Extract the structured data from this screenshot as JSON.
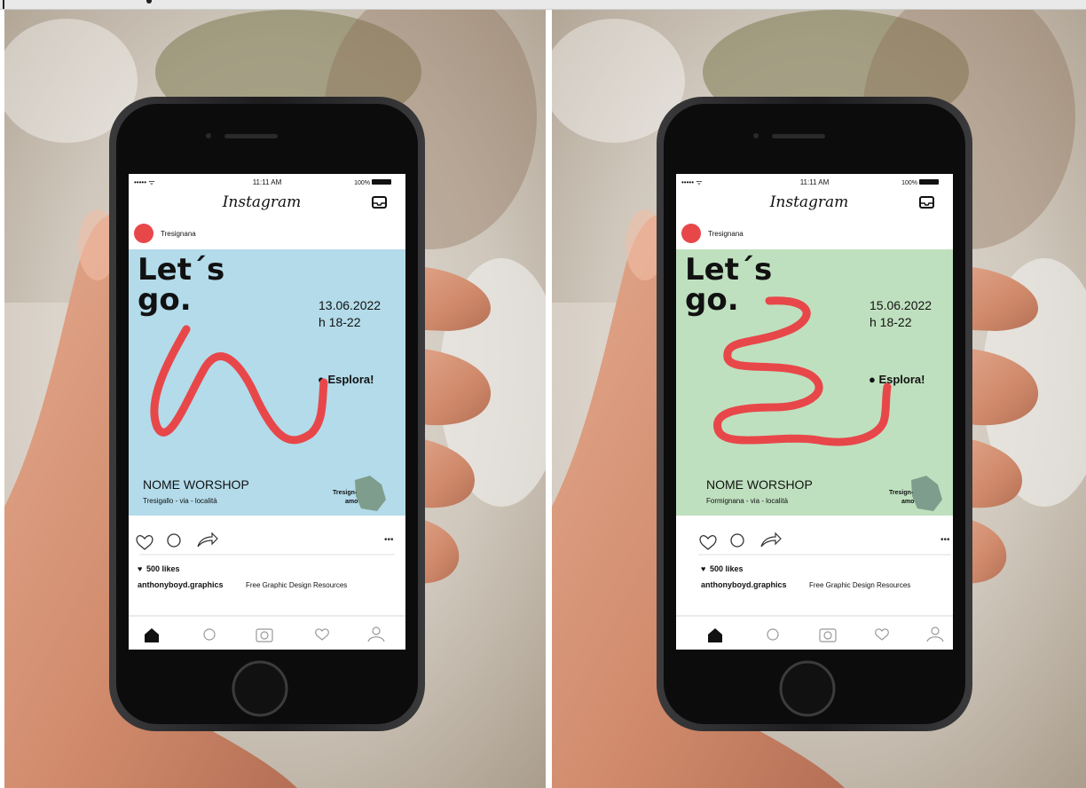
{
  "colors": {
    "post_left_bg": "#b3dbea",
    "post_right_bg": "#bfe0bf",
    "squiggle": "#e8474a",
    "text_dark": "#111111"
  },
  "panels": [
    {
      "status": {
        "time": "11:11 AM",
        "battery": "100%"
      },
      "app_title": "Instagram",
      "account": "Tresignana",
      "post": {
        "headline_line1": "Let´s",
        "headline_line2": "go.",
        "date": "13.06.2022",
        "hours": "h 18-22",
        "cta": "● Esplora!",
        "event_name": "NOME WORSHOP",
        "location": "Tresigallo - via - località",
        "logo_text_1": "Tresign-",
        "logo_text_2": "amo"
      },
      "likes": "500 likes",
      "caption_user": "anthonyboyd.graphics",
      "caption_text": "Free Graphic Design Resources"
    },
    {
      "status": {
        "time": "11:11 AM",
        "battery": "100%"
      },
      "app_title": "Instagram",
      "account": "Tresignana",
      "post": {
        "headline_line1": "Let´s",
        "headline_line2": "go.",
        "date": "15.06.2022",
        "hours": "h 18-22",
        "cta": "● Esplora!",
        "event_name": "NOME WORSHOP",
        "location": "Formignana - via - località",
        "logo_text_1": "Tresign-",
        "logo_text_2": "amo"
      },
      "likes": "500 likes",
      "caption_user": "anthonyboyd.graphics",
      "caption_text": "Free Graphic Design Resources"
    }
  ]
}
